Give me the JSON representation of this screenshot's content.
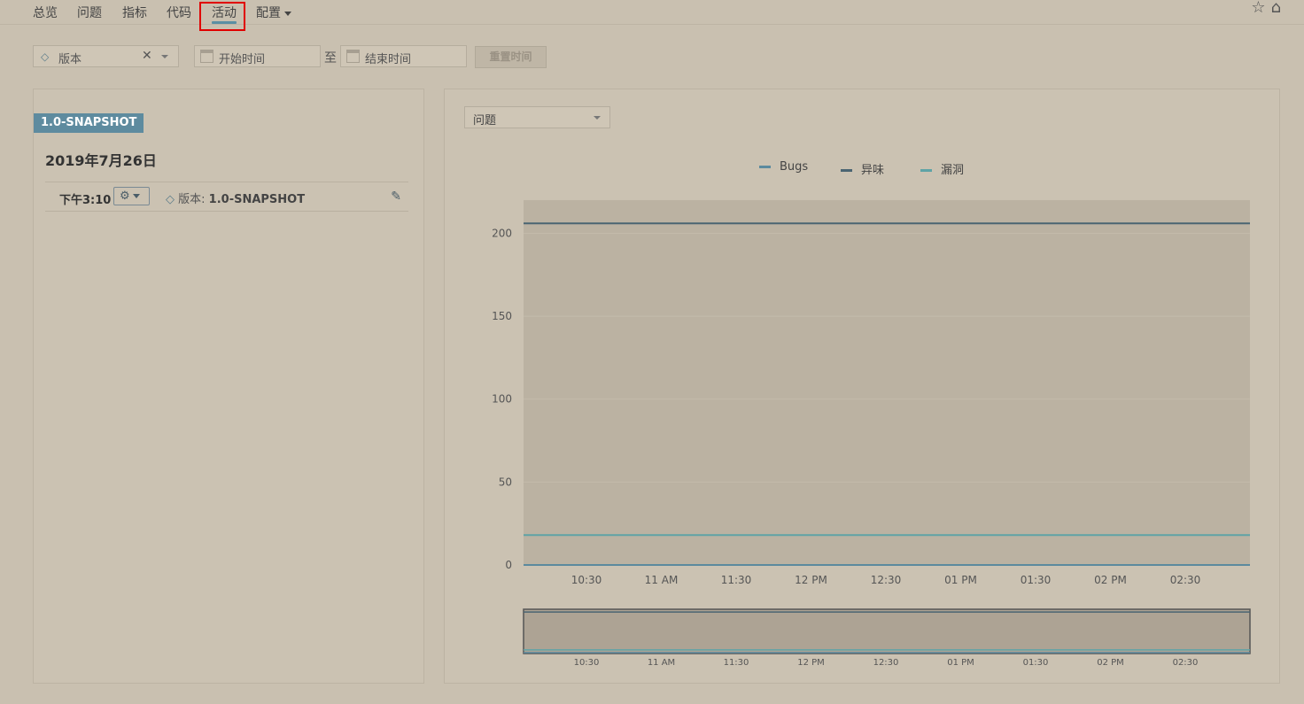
{
  "nav": {
    "items": [
      "总览",
      "问题",
      "指标",
      "代码",
      "活动",
      "配置"
    ],
    "active": "活动"
  },
  "icons": {
    "star": "star-icon",
    "home": "home-icon"
  },
  "filters": {
    "version_label": "版本",
    "start_placeholder": "开始时间",
    "to_label": "至",
    "end_placeholder": "结束时间",
    "reset_label": "重置时间"
  },
  "history": {
    "tag": "1.0-SNAPSHOT",
    "date": "2019年7月26日",
    "event": {
      "time": "下午3:10",
      "prefix": "版本:",
      "version": "1.0-SNAPSHOT"
    }
  },
  "graph": {
    "selector": "问题"
  },
  "colors": {
    "bugs": "#5b8a9e",
    "code_smells": "#4a6472",
    "vulnerabilities": "#5ea3a6",
    "active_tab": "#5b8fa3"
  },
  "chart_data": {
    "type": "line",
    "x": [
      "10:30",
      "11 AM",
      "11:30",
      "12 PM",
      "12:30",
      "01 PM",
      "01:30",
      "02 PM",
      "02:30"
    ],
    "ylim": [
      0,
      220
    ],
    "yticks": [
      0,
      50,
      100,
      150,
      200
    ],
    "series": [
      {
        "name": "Bugs",
        "value": 0,
        "color": "#5b8a9e"
      },
      {
        "name": "异味",
        "value": 206,
        "color": "#4a6472"
      },
      {
        "name": "漏洞",
        "value": 18,
        "color": "#5ea3a6"
      }
    ]
  }
}
